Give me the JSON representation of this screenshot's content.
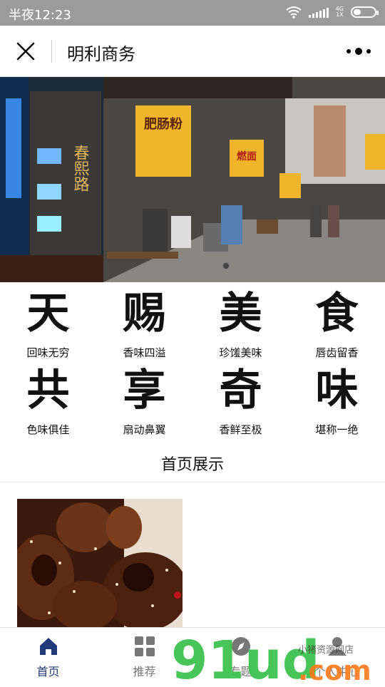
{
  "status": {
    "time": "半夜12:23",
    "network": "4G\n1X"
  },
  "header": {
    "title": "明利商务"
  },
  "grid": [
    {
      "big": "天",
      "small": "回味无穷"
    },
    {
      "big": "赐",
      "small": "香味四溢"
    },
    {
      "big": "美",
      "small": "珍馐美味"
    },
    {
      "big": "食",
      "small": "唇齿留香"
    },
    {
      "big": "共",
      "small": "色味俱佳"
    },
    {
      "big": "享",
      "small": "扇动鼻翼"
    },
    {
      "big": "奇",
      "small": "香鲜至极"
    },
    {
      "big": "味",
      "small": "堪称一绝"
    }
  ],
  "section_title": "首页展示",
  "tabs": [
    {
      "label": "首页",
      "icon": "home-icon"
    },
    {
      "label": "推荐",
      "icon": "grid-icon"
    },
    {
      "label": "专题",
      "icon": "compass-icon"
    },
    {
      "label": "个人中心",
      "icon": "user-icon"
    }
  ],
  "banner": {
    "signs": [
      "春熙路",
      "肥肠粉",
      "燃面"
    ]
  },
  "watermark": {
    "text": "91ud",
    "dotcom": ".com",
    "tagline": "小猪资源网店"
  },
  "colors": {
    "statusbar": "#9b9b9b",
    "accent": "#233a7a",
    "watermark_green": "#39c14a",
    "watermark_orange": "#ff7a1a"
  }
}
